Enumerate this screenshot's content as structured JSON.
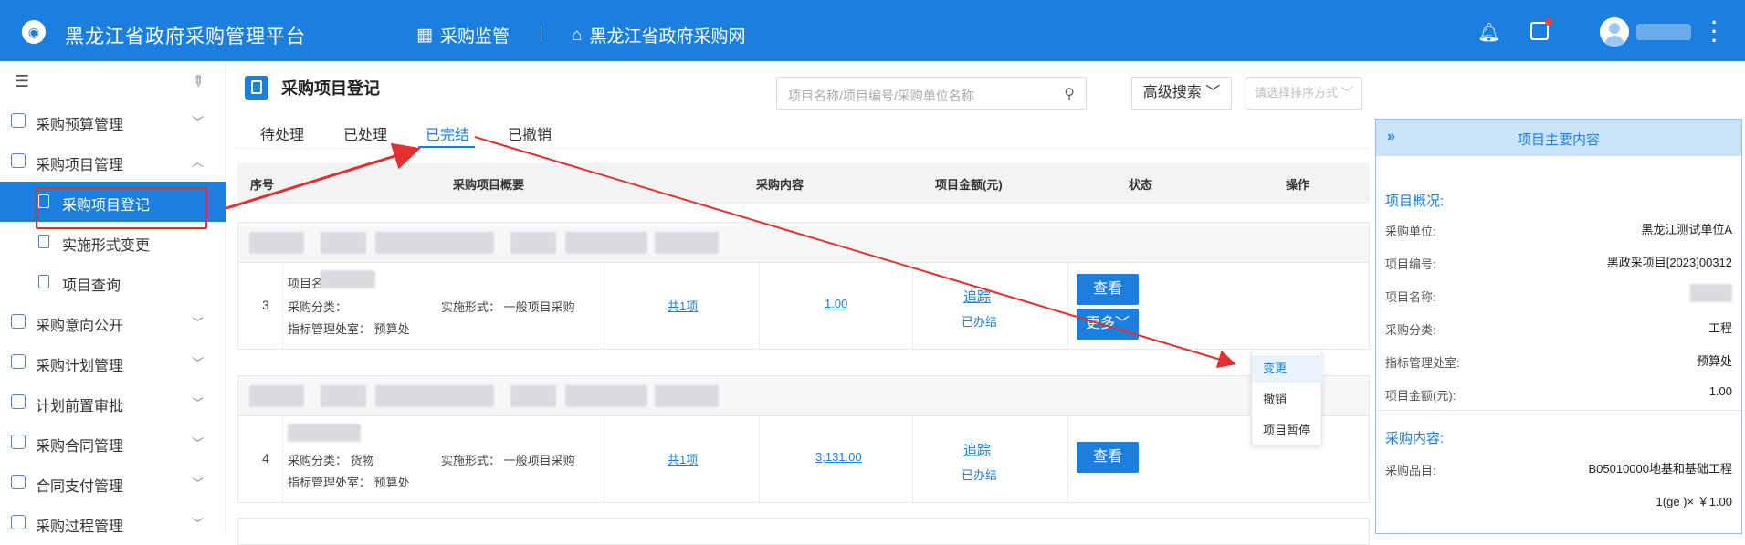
{
  "topbar": {
    "app_title": "黑龙江省政府采购管理平台",
    "nav_supervise": "采购监管",
    "nav_site": "黑龙江省政府采购网"
  },
  "sidebar": {
    "items": [
      {
        "label": "采购预算管理",
        "chevron": "down"
      },
      {
        "label": "采购项目管理",
        "chevron": "up"
      },
      {
        "label": "采购项目登记",
        "active": true
      },
      {
        "label": "实施形式变更"
      },
      {
        "label": "项目查询"
      },
      {
        "label": "采购意向公开",
        "chevron": "down"
      },
      {
        "label": "采购计划管理",
        "chevron": "down"
      },
      {
        "label": "计划前置审批",
        "chevron": "down"
      },
      {
        "label": "采购合同管理",
        "chevron": "down"
      },
      {
        "label": "合同支付管理",
        "chevron": "down"
      },
      {
        "label": "采购过程管理",
        "chevron": "down"
      }
    ]
  },
  "main": {
    "page_title": "采购项目登记",
    "search_placeholder": "项目名称/项目编号/采购单位名称",
    "advanced_search": "高级搜索",
    "sort_placeholder": "请选择排序方式",
    "tabs": [
      "待处理",
      "已处理",
      "已完结",
      "已撤销"
    ],
    "active_tab": "已完结",
    "table_headers": [
      "序号",
      "采购项目概要",
      "采购内容",
      "项目金额(元)",
      "状态",
      "操作"
    ],
    "rows": [
      {
        "index": "3",
        "summary_line1": "项目名",
        "summary_line2_label": "采购分类：",
        "summary_line2_extra": "实施形式：  一般项目采购",
        "summary_line3": "指标管理处室：  预算处",
        "content": "共1项",
        "amount": "1.00",
        "track": "追踪",
        "status": "已办结",
        "view": "查看",
        "more": "更多"
      },
      {
        "index": "4",
        "summary_line2": "采购分类：  货物",
        "summary_line2_extra": "实施形式：  一般项目采购",
        "summary_line3": "指标管理处室：  预算处",
        "content": "共1项",
        "amount": "3,131.00",
        "track": "追踪",
        "status": "已办结",
        "view": "查看"
      }
    ],
    "dropdown": [
      "变更",
      "撤销",
      "项目暂停"
    ]
  },
  "panel": {
    "title": "项目主要内容",
    "overview_title": "项目概况:",
    "fields": [
      {
        "k": "采购单位:",
        "v": "黑龙江测试单位A"
      },
      {
        "k": "项目编号:",
        "v": "黑政采项目[2023]00312"
      },
      {
        "k": "项目名称:",
        "v": ""
      },
      {
        "k": "采购分类:",
        "v": "工程"
      },
      {
        "k": "指标管理处室:",
        "v": "预算处"
      },
      {
        "k": "项目金额(元):",
        "v": "1.00"
      }
    ],
    "content_title": "采购内容:",
    "item_label": "采购品目:",
    "item_value": "B05010000地基和基础工程",
    "item_qty": "1(ge )× ￥1.00"
  },
  "colors": {
    "primary": "#1b7fe0",
    "annotation_red": "#e23030"
  }
}
